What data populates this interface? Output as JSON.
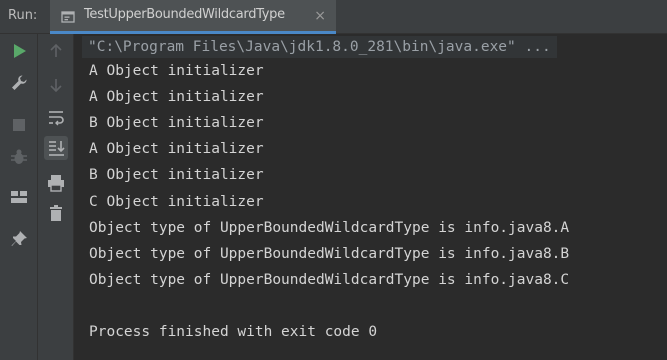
{
  "run_panel": {
    "label": "Run:",
    "tab": {
      "title": "TestUpperBoundedWildcardType",
      "close_glyph": "×",
      "icon": "run-config-icon"
    }
  },
  "toolbar_left": [
    {
      "icon": "rerun-icon",
      "color": "#59a869"
    },
    {
      "icon": "wrench-icon",
      "color": "#afb1b3"
    },
    {
      "icon": "stop-icon",
      "color": "#5f6265"
    },
    {
      "icon": "debug-bug-icon",
      "color": "#5f6265"
    },
    {
      "icon": "layout-icon",
      "color": "#afb1b3"
    },
    {
      "icon": "pin-icon",
      "color": "#afb1b3"
    }
  ],
  "toolbar_right": [
    {
      "icon": "up-arrow-icon"
    },
    {
      "icon": "down-arrow-icon"
    },
    {
      "icon": "soft-wrap-icon"
    },
    {
      "icon": "scroll-to-end-icon",
      "pressed": true
    },
    {
      "icon": "print-icon"
    },
    {
      "icon": "trash-icon"
    }
  ],
  "console": {
    "command": "\"C:\\Program Files\\Java\\jdk1.8.0_281\\bin\\java.exe\" ...",
    "lines": [
      "A Object initializer",
      "A Object initializer",
      "B Object initializer",
      "A Object initializer",
      "B Object initializer",
      "C Object initializer",
      "Object type of UpperBoundedWildcardType is info.java8.A",
      "Object type of UpperBoundedWildcardType is info.java8.B",
      "Object type of UpperBoundedWildcardType is info.java8.C",
      "",
      "Process finished with exit code 0"
    ]
  },
  "colors": {
    "panel_bg": "#3c3f41",
    "console_bg": "#2b2b2b",
    "tab_underline": "#4a88c7",
    "run_green": "#59a869",
    "console_text": "#d4d4d4"
  }
}
